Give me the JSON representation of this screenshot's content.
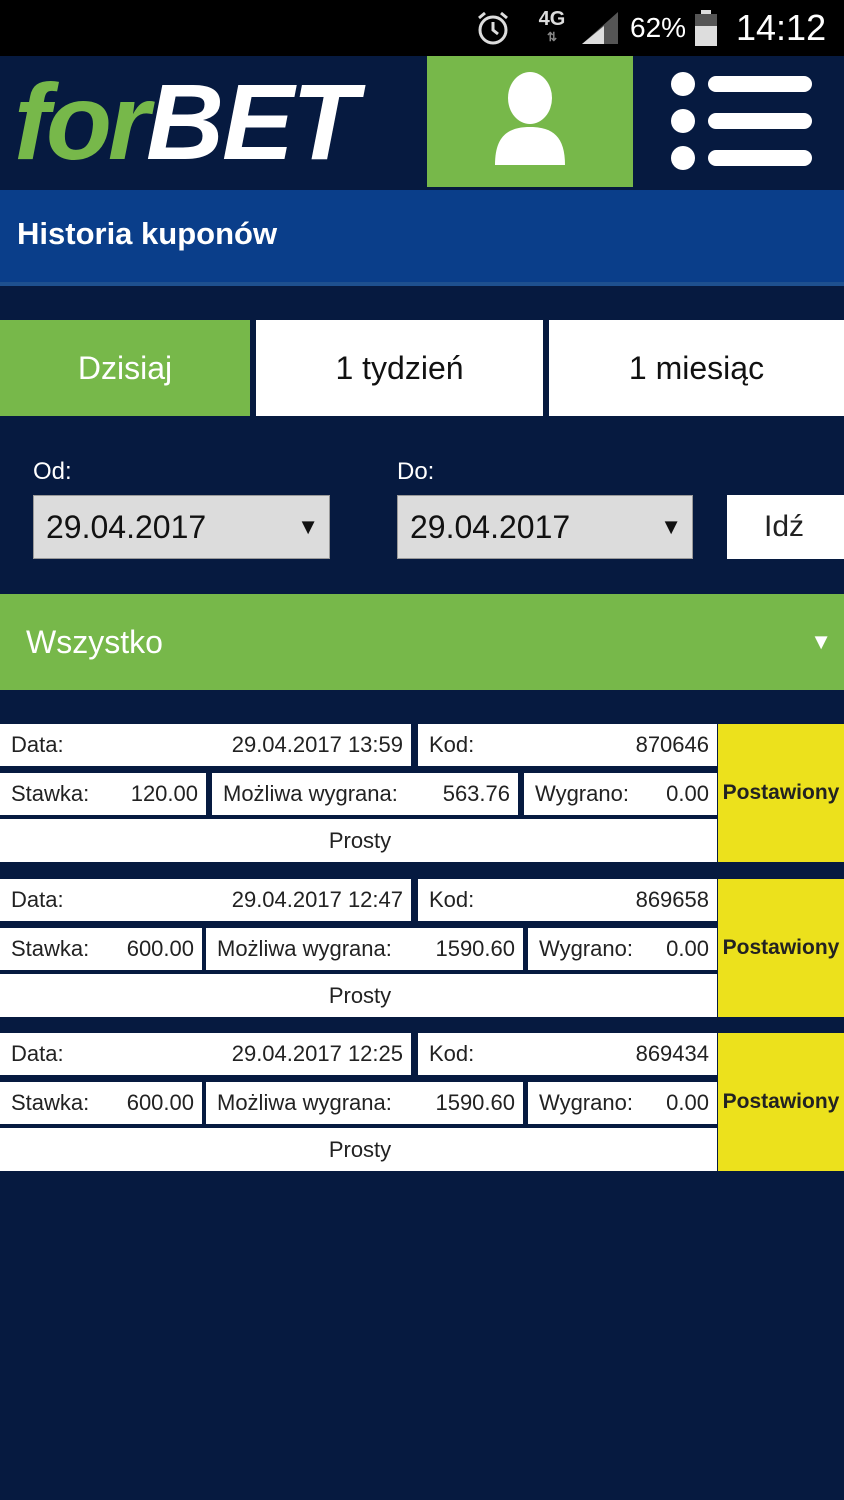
{
  "status_bar": {
    "network": "4G",
    "battery": "62%",
    "time": "14:12"
  },
  "header": {
    "logo_for": "for",
    "logo_bet": "BET",
    "user_icon": "user-icon",
    "menu_icon": "hamburger-menu-icon"
  },
  "page": {
    "title": "Historia kuponów"
  },
  "tabs": [
    {
      "label": "Dzisiaj",
      "active": true
    },
    {
      "label": "1 tydzień",
      "active": false
    },
    {
      "label": "1 miesiąc",
      "active": false
    }
  ],
  "filter": {
    "from_label": "Od:",
    "from_value": "29.04.2017",
    "to_label": "Do:",
    "to_value": "29.04.2017",
    "go_label": "Idź",
    "status_value": "Wszystko"
  },
  "labels": {
    "data": "Data:",
    "kod": "Kod:",
    "stawka": "Stawka:",
    "mozliwa": "Możliwa wygrana:",
    "wygrano": "Wygrano:"
  },
  "coupons": [
    {
      "date": "29.04.2017 13:59",
      "code": "870646",
      "stake": "120.00",
      "possible_win": "563.76",
      "won": "0.00",
      "type": "Prosty",
      "status": "Postawiony"
    },
    {
      "date": "29.04.2017 12:47",
      "code": "869658",
      "stake": "600.00",
      "possible_win": "1590.60",
      "won": "0.00",
      "type": "Prosty",
      "status": "Postawiony"
    },
    {
      "date": "29.04.2017 12:25",
      "code": "869434",
      "stake": "600.00",
      "possible_win": "1590.60",
      "won": "0.00",
      "type": "Prosty",
      "status": "Postawiony"
    }
  ],
  "colors": {
    "background": "#061a40",
    "accent_green": "#77b84a",
    "title_blue": "#0a3e8a",
    "status_yellow": "#ece11c"
  }
}
